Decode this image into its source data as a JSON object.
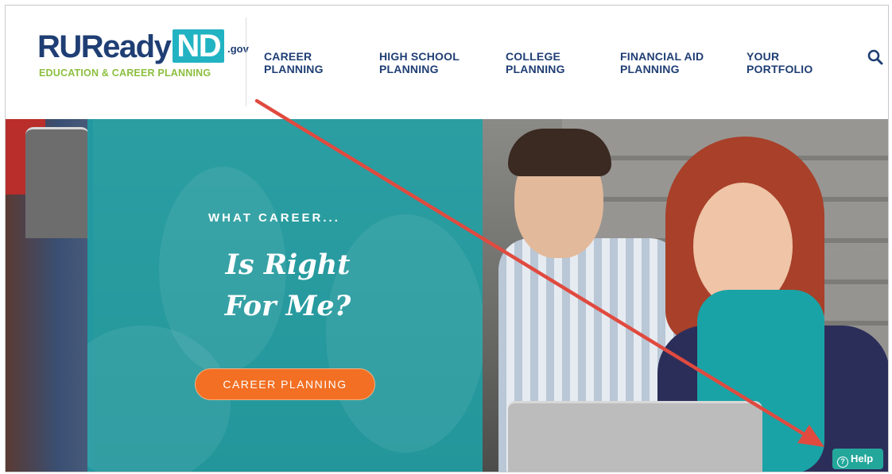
{
  "header": {
    "logo": {
      "main": "RUReady",
      "highlight": "ND",
      "suffix": ".gov",
      "tagline": "EDUCATION & CAREER PLANNING"
    },
    "nav": [
      {
        "line1": "CAREER",
        "line2": "PLANNING"
      },
      {
        "line1": "HIGH SCHOOL",
        "line2": "PLANNING"
      },
      {
        "line1": "COLLEGE",
        "line2": "PLANNING"
      },
      {
        "line1": "FINANCIAL AID",
        "line2": "PLANNING"
      },
      {
        "line1": "YOUR",
        "line2": "PORTFOLIO"
      }
    ],
    "search_icon": "search-icon"
  },
  "hero": {
    "subtitle": "WHAT CAREER...",
    "title_line1": "Is Right",
    "title_line2": "For Me?",
    "button_label": "CAREER PLANNING"
  },
  "help": {
    "icon": "?",
    "label": "Help"
  },
  "colors": {
    "brand_navy": "#1f3e74",
    "brand_teal": "#22b3c3",
    "brand_green": "#8cbf3f",
    "button_orange": "#f26f23",
    "help_teal": "#24a79b",
    "annotation_red": "#e04a3f"
  }
}
